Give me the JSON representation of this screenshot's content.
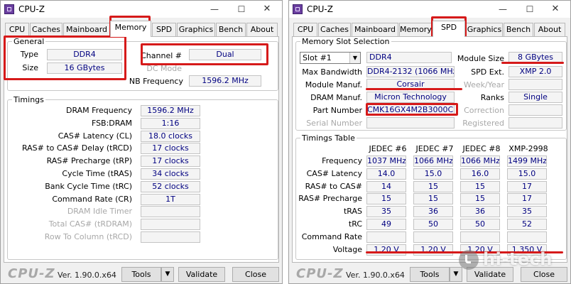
{
  "app": {
    "title": "CPU-Z",
    "version": "Ver. 1.90.0.x64",
    "logo": "CPU-Z"
  },
  "window_controls": {
    "minimize": "—",
    "maximize": "☐",
    "close": "✕"
  },
  "tabs": [
    "CPU",
    "Caches",
    "Mainboard",
    "Memory",
    "SPD",
    "Graphics",
    "Bench",
    "About"
  ],
  "footer": {
    "tools": "Tools",
    "validate": "Validate",
    "close": "Close",
    "dropdown_icon": "▼"
  },
  "memory": {
    "active_tab": "Memory",
    "general": {
      "legend": "General",
      "type_label": "Type",
      "type": "DDR4",
      "size_label": "Size",
      "size": "16 GBytes",
      "channel_label": "Channel #",
      "channel": "Dual",
      "dc_mode_label": "DC Mode",
      "dc_mode": "",
      "nb_freq_label": "NB Frequency",
      "nb_freq": "1596.2 MHz"
    },
    "timings": {
      "legend": "Timings",
      "rows": [
        {
          "label": "DRAM Frequency",
          "value": "1596.2 MHz",
          "enabled": true
        },
        {
          "label": "FSB:DRAM",
          "value": "1:16",
          "enabled": true
        },
        {
          "label": "CAS# Latency (CL)",
          "value": "18.0 clocks",
          "enabled": true
        },
        {
          "label": "RAS# to CAS# Delay (tRCD)",
          "value": "17 clocks",
          "enabled": true
        },
        {
          "label": "RAS# Precharge (tRP)",
          "value": "17 clocks",
          "enabled": true
        },
        {
          "label": "Cycle Time (tRAS)",
          "value": "34 clocks",
          "enabled": true
        },
        {
          "label": "Bank Cycle Time (tRC)",
          "value": "52 clocks",
          "enabled": true
        },
        {
          "label": "Command Rate (CR)",
          "value": "1T",
          "enabled": true
        },
        {
          "label": "DRAM Idle Timer",
          "value": "",
          "enabled": false
        },
        {
          "label": "Total CAS# (tRDRAM)",
          "value": "",
          "enabled": false
        },
        {
          "label": "Row To Column (tRCD)",
          "value": "",
          "enabled": false
        }
      ]
    }
  },
  "spd": {
    "active_tab": "SPD",
    "slot_legend": "Memory Slot Selection",
    "slot": "Slot #1",
    "slot_type": "DDR4",
    "module_size_label": "Module Size",
    "module_size": "8 GBytes",
    "max_bw_label": "Max Bandwidth",
    "max_bw": "DDR4-2132 (1066 MHz)",
    "spd_ext_label": "SPD Ext.",
    "spd_ext": "XMP 2.0",
    "manuf_label": "Module Manuf.",
    "manuf": "Corsair",
    "week_label": "Week/Year",
    "week": "",
    "dram_manuf_label": "DRAM Manuf.",
    "dram_manuf": "Micron Technology",
    "ranks_label": "Ranks",
    "ranks": "Single",
    "part_label": "Part Number",
    "part": "CMK16GX4M2B3000C15",
    "correction_label": "Correction",
    "correction": "",
    "serial_label": "Serial Number",
    "serial": "",
    "registered_label": "Registered",
    "registered": "",
    "table": {
      "legend": "Timings Table",
      "columns": [
        "JEDEC #6",
        "JEDEC #7",
        "JEDEC #8",
        "XMP-2998"
      ],
      "rows": [
        {
          "label": "Frequency",
          "values": [
            "1037 MHz",
            "1066 MHz",
            "1066 MHz",
            "1499 MHz"
          ]
        },
        {
          "label": "CAS# Latency",
          "values": [
            "14.0",
            "15.0",
            "16.0",
            "15.0"
          ]
        },
        {
          "label": "RAS# to CAS#",
          "values": [
            "14",
            "15",
            "15",
            "17"
          ]
        },
        {
          "label": "RAS# Precharge",
          "values": [
            "15",
            "15",
            "15",
            "17"
          ]
        },
        {
          "label": "tRAS",
          "values": [
            "35",
            "36",
            "36",
            "35"
          ]
        },
        {
          "label": "tRC",
          "values": [
            "49",
            "50",
            "50",
            "52"
          ]
        },
        {
          "label": "Command Rate",
          "values": [
            "",
            "",
            "",
            ""
          ]
        },
        {
          "label": "Voltage",
          "values": [
            "1.20 V",
            "1.20 V",
            "1.20 V",
            "1.350 V"
          ]
        }
      ]
    }
  },
  "watermark": {
    "text": "hi-tech"
  },
  "colors": {
    "highlight": "#d61a1a",
    "value_text": "#000080",
    "disabled_text": "#a8a8a8"
  }
}
